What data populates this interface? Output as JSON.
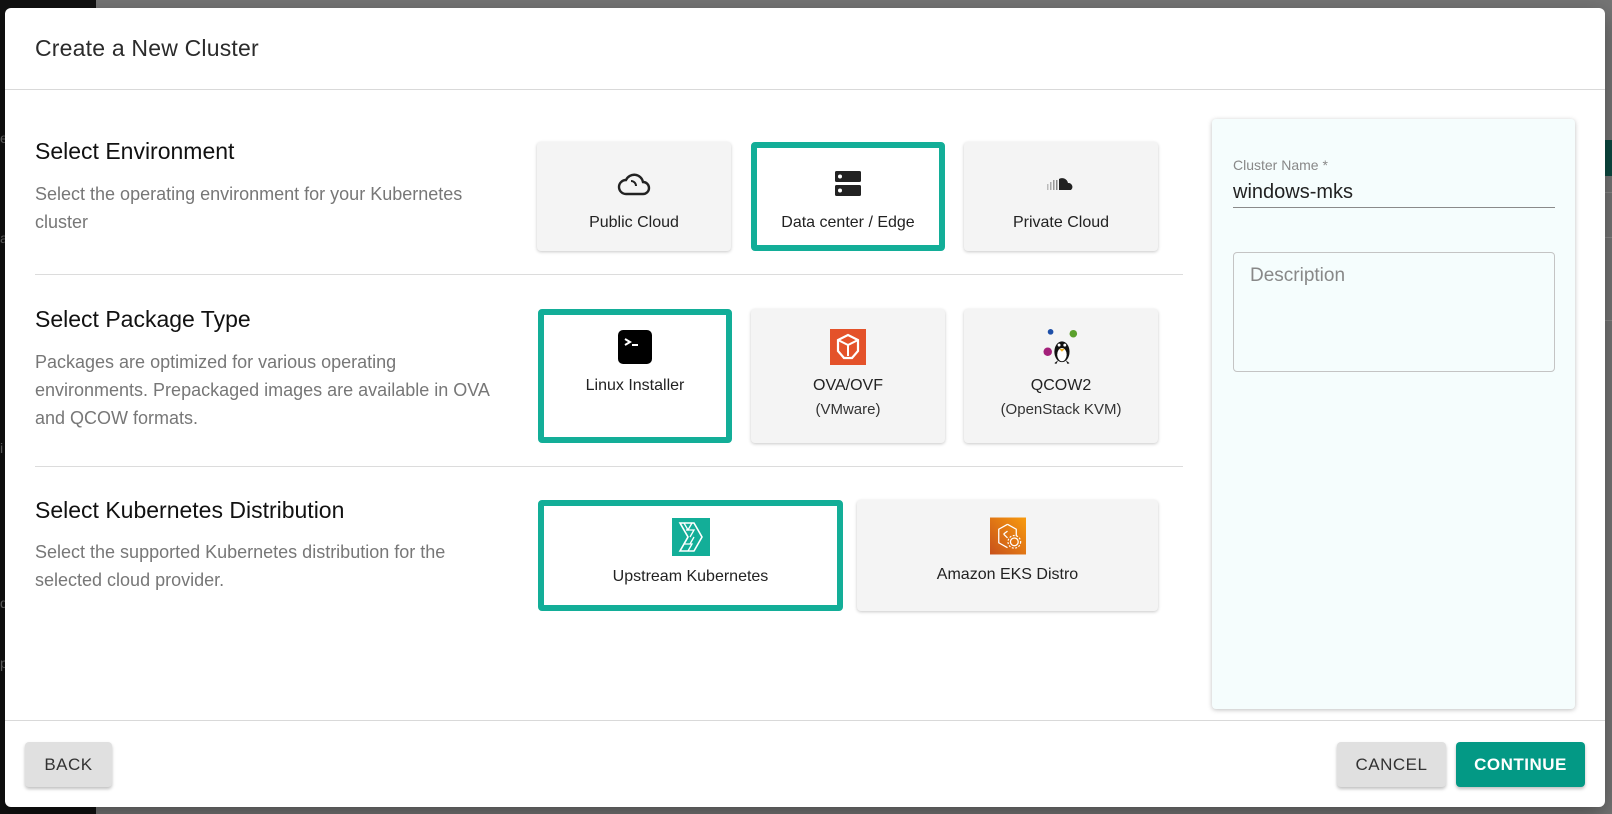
{
  "background": {
    "left_ghost_chars": [
      "e",
      "a",
      "i",
      "d",
      "p"
    ]
  },
  "dialog": {
    "title": "Create a New Cluster",
    "sections": [
      {
        "title": "Select Environment",
        "description": "Select the operating environment for your Kubernetes cluster",
        "options": [
          {
            "label": "Public Cloud",
            "icon": "cloud-outline-icon",
            "selected": false
          },
          {
            "label": "Data center / Edge",
            "icon": "server-icon",
            "selected": true
          },
          {
            "label": "Private Cloud",
            "icon": "soundcloud-icon",
            "selected": false
          }
        ]
      },
      {
        "title": "Select Package Type",
        "description": "Packages are optimized for various operating environments. Prepackaged images are available in OVA and QCOW formats.",
        "options": [
          {
            "label": "Linux Installer",
            "sublabel": "",
            "icon": "terminal-icon",
            "selected": true
          },
          {
            "label": "OVA/OVF",
            "sublabel": "(VMware)",
            "icon": "virtualbox-icon",
            "selected": false
          },
          {
            "label": "QCOW2",
            "sublabel": "(OpenStack KVM)",
            "icon": "tux-juggling-icon",
            "selected": false
          }
        ]
      },
      {
        "title": "Select Kubernetes Distribution",
        "description": "Select the supported Kubernetes distribution for the selected cloud provider.",
        "options": [
          {
            "label": "Upstream Kubernetes",
            "icon": "kubernetes-upstream-icon",
            "selected": true
          },
          {
            "label": "Amazon EKS Distro",
            "icon": "eks-distro-icon",
            "selected": false
          }
        ]
      }
    ],
    "form": {
      "cluster_name_label": "Cluster Name *",
      "cluster_name_value": "windows-mks",
      "description_placeholder": "Description",
      "description_value": ""
    },
    "footer": {
      "back_label": "BACK",
      "cancel_label": "CANCEL",
      "continue_label": "CONTINUE"
    }
  },
  "colors": {
    "accent": "#13ae98",
    "primary_button": "#039985",
    "panel_bg": "#f5fdfd",
    "card_bg": "#f4f4f4"
  }
}
